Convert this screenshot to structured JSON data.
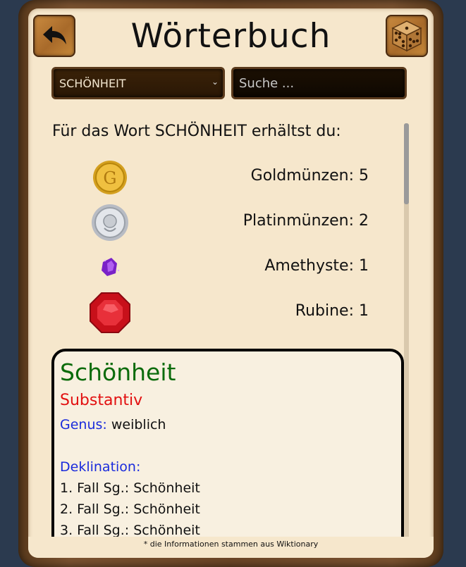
{
  "header": {
    "title": "Wörterbuch"
  },
  "controls": {
    "selected_word": "SCHÖNHEIT",
    "search_placeholder": "Suche ..."
  },
  "rewards": {
    "intro": "Für das Wort SCHÖNHEIT erhältst du:",
    "items": [
      {
        "icon": "gold-coin-icon",
        "label": "Goldmünzen: 5",
        "value": 5
      },
      {
        "icon": "platinum-coin-icon",
        "label": "Platinmünzen: 2",
        "value": 2
      },
      {
        "icon": "amethyst-icon",
        "label": "Amethyste: 1",
        "value": 1
      },
      {
        "icon": "ruby-icon",
        "label": "Rubine: 1",
        "value": 1
      }
    ]
  },
  "entry": {
    "word": "Schönheit",
    "part_of_speech": "Substantiv",
    "genus_label": "Genus:",
    "genus_value": "weiblich",
    "declension_label": "Deklination:",
    "cases": [
      "1. Fall Sg.: Schönheit",
      "2. Fall Sg.: Schönheit",
      "3. Fall Sg.: Schönheit"
    ]
  },
  "footnote": "* die Informationen stammen aus Wiktionary",
  "colors": {
    "word": "#0b6b0b",
    "part_of_speech": "#e21010",
    "labels": "#1a2bdc",
    "wood": "#6b4526",
    "parchment": "#f6e7cc"
  }
}
